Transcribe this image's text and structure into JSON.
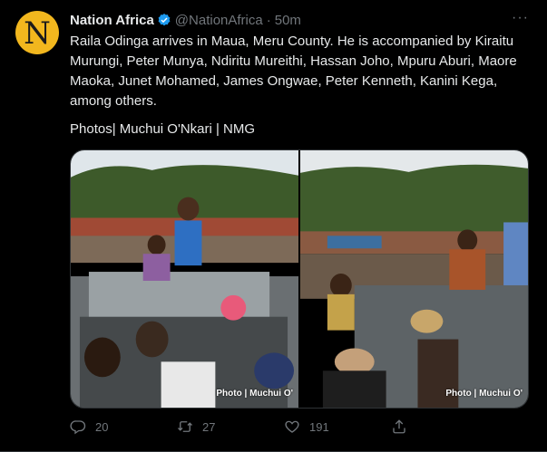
{
  "tweet": {
    "avatar_letter": "N",
    "author_name": "Nation Africa",
    "handle": "@NationAfrica",
    "separator": "·",
    "time": "50m",
    "more_label": "···",
    "text": "Raila Odinga arrives in Maua, Meru County. He is accompanied by Kiraitu Murungi, Peter Munya, Ndiritu Mureithi, Hassan Joho, Mpuru Aburi, Maore Maoka, Junet Mohamed, James Ongwae, Peter Kenneth, Kanini Kega, among others.",
    "credit": "Photos| Muchui O'Nkari | NMG"
  },
  "media": {
    "photos": [
      {
        "watermark": "Photo | Muchui O'"
      },
      {
        "watermark": "Photo | Muchui O'"
      }
    ]
  },
  "actions": {
    "reply_count": "20",
    "retweet_count": "27",
    "like_count": "191"
  },
  "colors": {
    "background": "#000000",
    "text": "#e7e9ea",
    "secondary": "#71767b",
    "avatar_bg": "#f2b71e",
    "verified": "#1d9bf0"
  }
}
